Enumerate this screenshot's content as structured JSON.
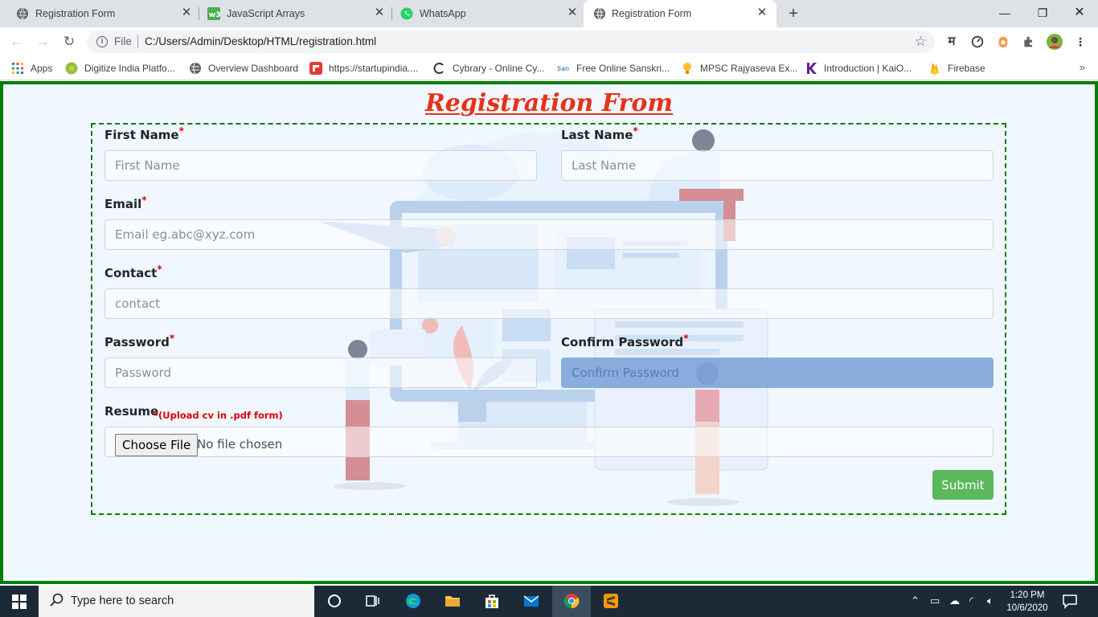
{
  "browser": {
    "tabs": [
      {
        "title": "Registration Form",
        "active": false
      },
      {
        "title": "JavaScript Arrays",
        "active": false
      },
      {
        "title": "WhatsApp",
        "active": false
      },
      {
        "title": "Registration Form",
        "active": true
      }
    ],
    "address": {
      "scheme_label": "File",
      "url": "C:/Users/Admin/Desktop/HTML/registration.html"
    },
    "bookmarks": [
      {
        "label": "Apps",
        "icon": "apps-grid-icon"
      },
      {
        "label": "Digitize India Platfo...",
        "icon": "digitize-india-icon"
      },
      {
        "label": "Overview Dashboard",
        "icon": "globe-icon"
      },
      {
        "label": "https://startupindia....",
        "icon": "startup-india-icon"
      },
      {
        "label": "Cybrary - Online Cy...",
        "icon": "cybrary-icon"
      },
      {
        "label": "Free Online Sanskri...",
        "icon": "sanskrit-icon"
      },
      {
        "label": "MPSC Rajyaseva Ex...",
        "icon": "bulb-icon"
      },
      {
        "label": "Introduction | KaiO...",
        "icon": "kaios-icon"
      },
      {
        "label": "Firebase",
        "icon": "firebase-icon"
      }
    ],
    "extension_glyph": "म"
  },
  "page": {
    "title": "Registration From",
    "required_mark": "*",
    "fields": {
      "first_name": {
        "label": "First Name",
        "placeholder": "First Name"
      },
      "last_name": {
        "label": "Last Name",
        "placeholder": "Last Name"
      },
      "email": {
        "label": "Email",
        "placeholder": "Email eg.abc@xyz.com"
      },
      "contact": {
        "label": "Contact",
        "placeholder": "contact"
      },
      "password": {
        "label": "Password",
        "placeholder": "Password"
      },
      "confirm_password": {
        "label": "Confirm Password",
        "placeholder": "Confirm Password"
      },
      "resume": {
        "label": "Resume",
        "note": "*(Upload cv in .pdf form)",
        "button": "Choose File",
        "status": "No file chosen"
      }
    },
    "submit_label": "Submit",
    "colors": {
      "title": "#e8311a",
      "border": "#008000",
      "submit": "#5cb85c",
      "required": "#e00000"
    }
  },
  "taskbar": {
    "search_placeholder": "Type here to search",
    "time": "1:20 PM",
    "date": "10/6/2020"
  }
}
